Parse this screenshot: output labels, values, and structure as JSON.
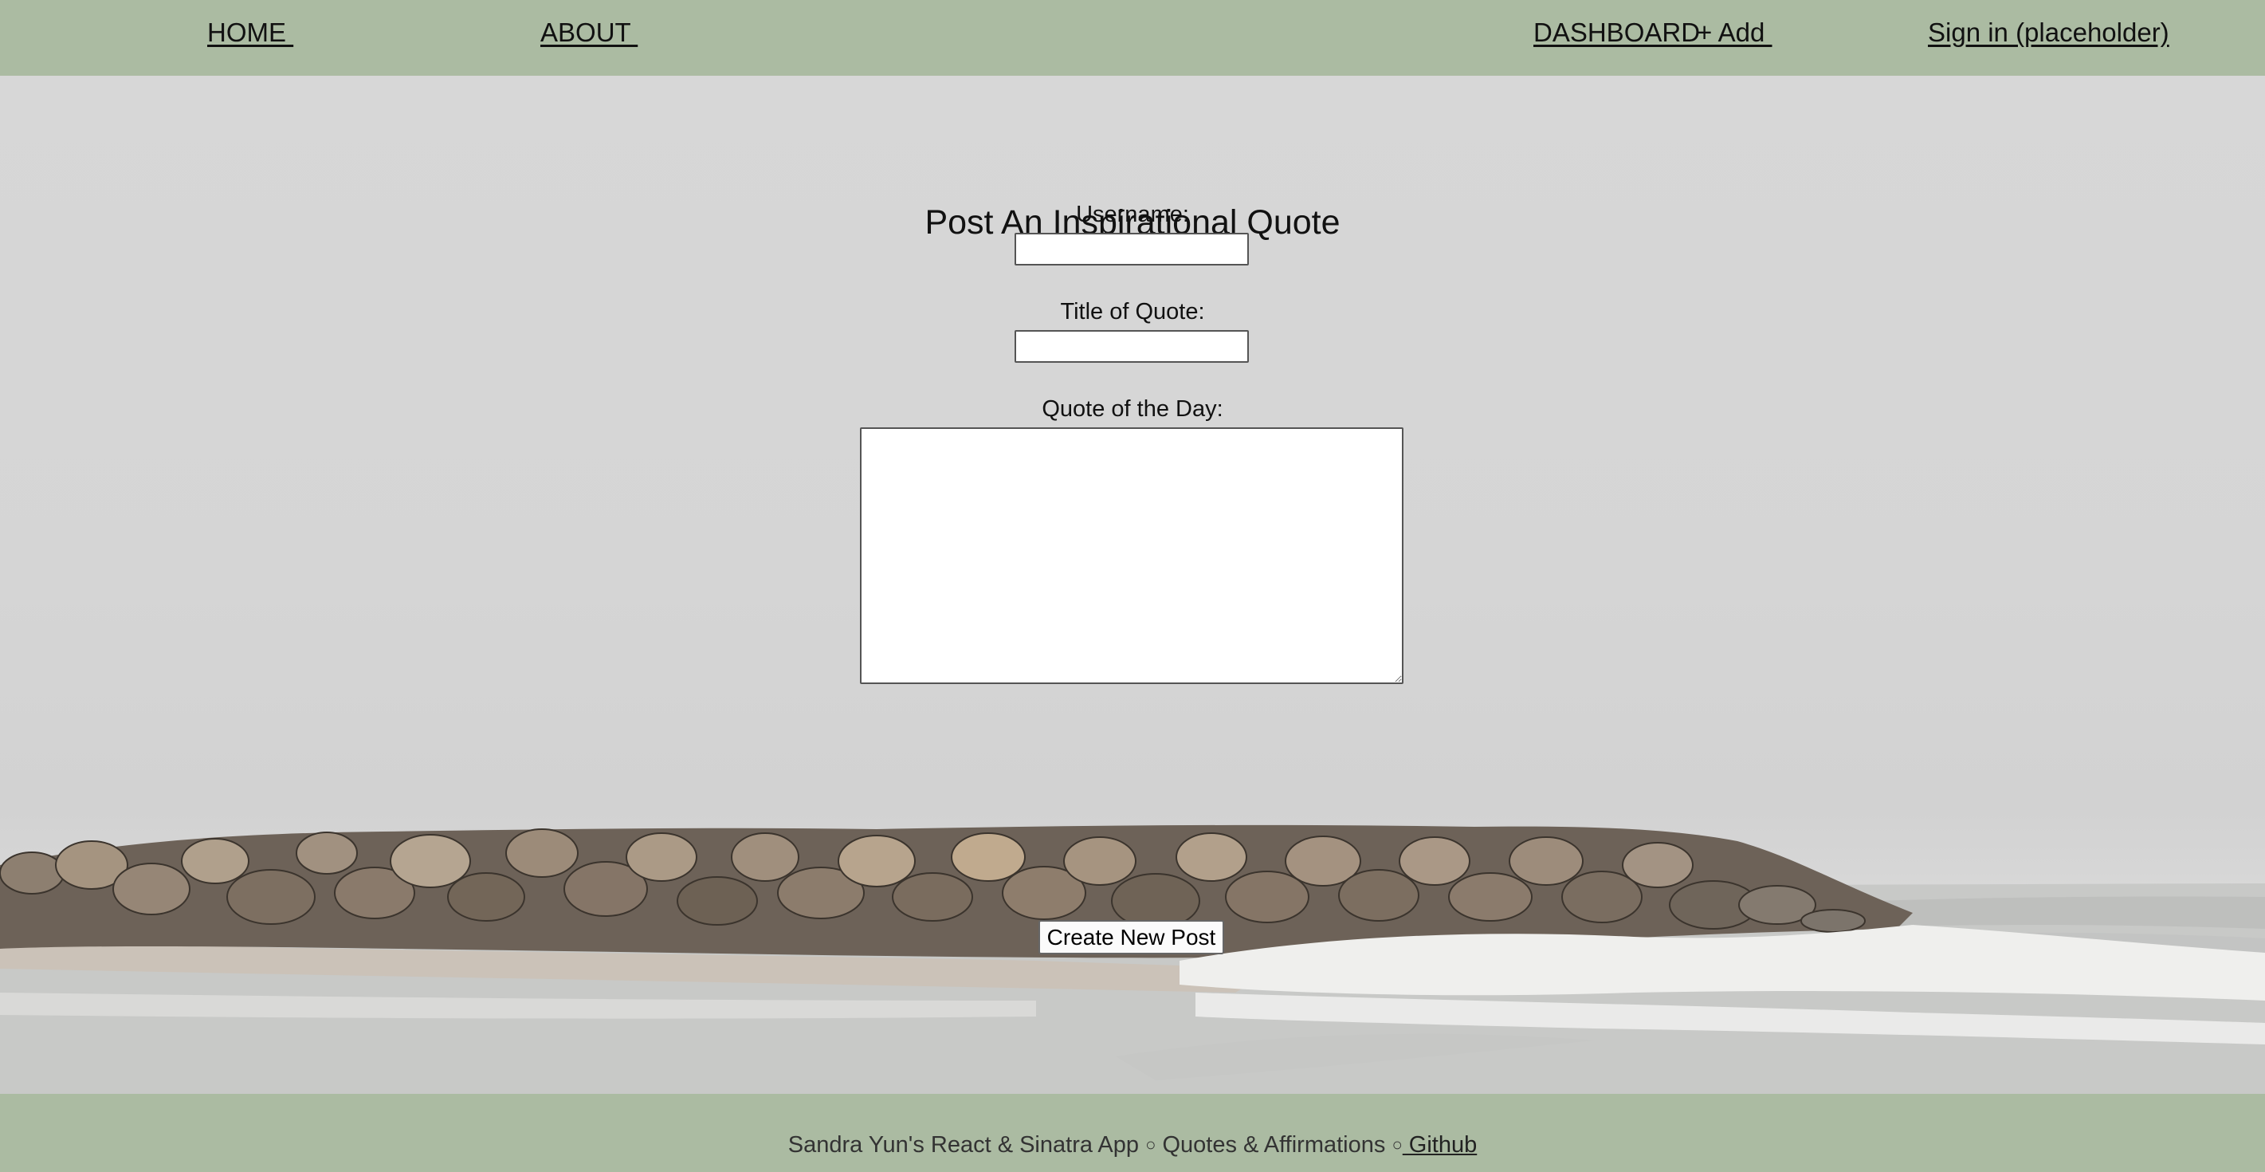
{
  "nav": {
    "home": "HOME ",
    "about": "ABOUT ",
    "dashboard": "DASHBOARD ",
    "add": "+ Add ",
    "sign_in": "Sign in (placeholder)"
  },
  "form": {
    "title": "Post An Inspirational Quote",
    "username_label": "Username:",
    "username_value": "",
    "quote_title_label": "Title of Quote:",
    "quote_title_value": "",
    "quote_label": "Quote of the Day:",
    "quote_value": "",
    "submit_label": "Create New Post"
  },
  "footer": {
    "credit": "Sandra Yun's React & Sinatra App",
    "separator": "○",
    "tagline": "Quotes & Affirmations",
    "github_link": " Github"
  },
  "colors": {
    "nav_background": "#abbba2",
    "footer_background": "#abbba2",
    "page_background": "#d7d7d7"
  }
}
